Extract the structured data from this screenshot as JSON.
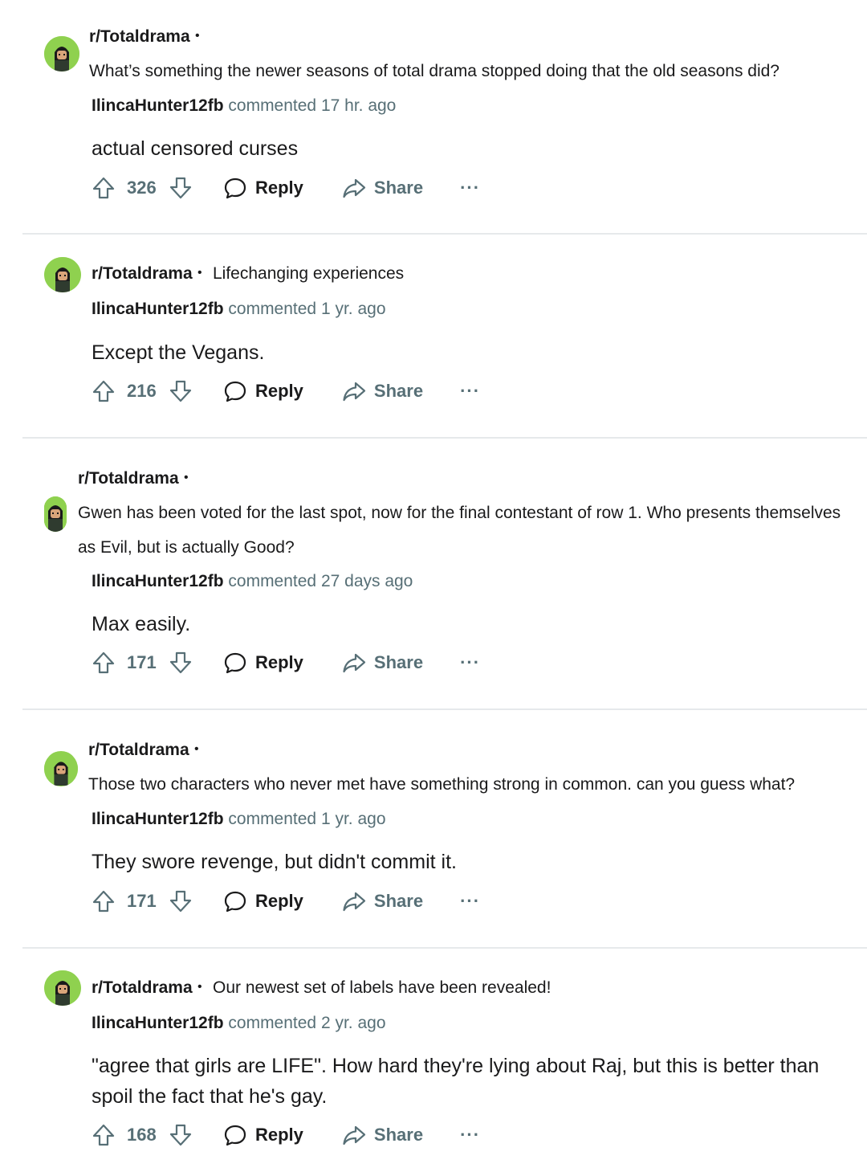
{
  "comments": [
    {
      "subreddit": "r/Totaldrama",
      "post_title": "What’s something the newer seasons of total drama stopped doing that the old seasons did?",
      "username": "IlincaHunter12fb",
      "when": "commented 17 hr. ago",
      "body": "actual censored curses",
      "score": "326",
      "reply_label": "Reply",
      "share_label": "Share",
      "more_label": "···"
    },
    {
      "subreddit": "r/Totaldrama",
      "post_title": "Lifechanging experiences",
      "username": "IlincaHunter12fb",
      "when": "commented 1 yr. ago",
      "body": "Except the Vegans.",
      "score": "216",
      "reply_label": "Reply",
      "share_label": "Share",
      "more_label": "···"
    },
    {
      "subreddit": "r/Totaldrama",
      "post_title": "Gwen has been voted for the last spot, now for the final contestant of row 1. Who presents themselves as Evil, but is actually Good?",
      "username": "IlincaHunter12fb",
      "when": "commented 27 days ago",
      "body": "Max easily.",
      "score": "171",
      "reply_label": "Reply",
      "share_label": "Share",
      "more_label": "···"
    },
    {
      "subreddit": "r/Totaldrama",
      "post_title": "Those two characters who never met have something strong in common. can you guess what?",
      "username": "IlincaHunter12fb",
      "when": "commented 1 yr. ago",
      "body": "They swore revenge, but didn't commit it.",
      "score": "171",
      "reply_label": "Reply",
      "share_label": "Share",
      "more_label": "···"
    },
    {
      "subreddit": "r/Totaldrama",
      "post_title": "Our newest set of labels have been revealed!",
      "username": "IlincaHunter12fb",
      "when": "commented 2 yr. ago",
      "body": "\"agree that girls are LIFE\". How hard they're lying about Raj, but this is better than spoil the fact that he's gay.",
      "score": "168",
      "reply_label": "Reply",
      "share_label": "Share",
      "more_label": "···"
    }
  ],
  "separator": "•",
  "colors": {
    "avatar_bg": "#8fd14f",
    "meta_gray": "#576f76",
    "divider": "#e6e9eb"
  }
}
